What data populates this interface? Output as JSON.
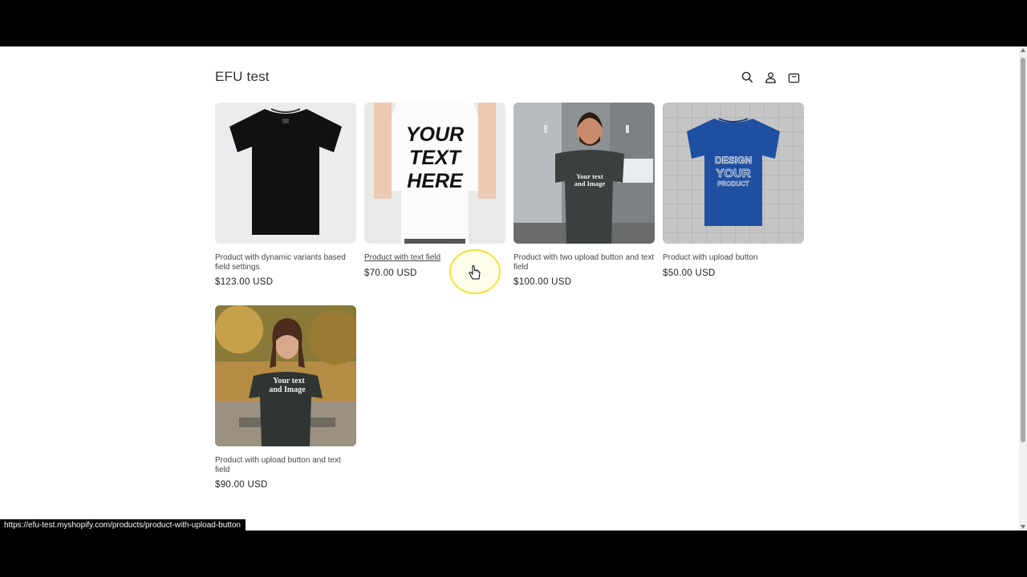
{
  "store": {
    "name": "EFU test"
  },
  "header_icons": [
    "search-icon",
    "account-icon",
    "cart-icon"
  ],
  "products": [
    {
      "title": "Product with dynamic variants based field settings",
      "price": "$123.00 USD",
      "image": "black-tshirt"
    },
    {
      "title": "Product with text field",
      "price": "$70.00 USD",
      "image": "white-tshirt-your-text-here",
      "image_text": "YOUR TEXT HERE"
    },
    {
      "title": "Product with two upload button and text field",
      "price": "$100.00 USD",
      "image": "man-grey-tshirt",
      "image_text": "Your text and Image"
    },
    {
      "title": "Product with upload button",
      "price": "$50.00 USD",
      "image": "blue-tshirt-design",
      "image_text": "DESIGN YOUR PRODUCT"
    },
    {
      "title": "Product with upload button and text field",
      "price": "$90.00 USD",
      "image": "woman-grey-tshirt",
      "image_text": "Your text and Image"
    }
  ],
  "status_bar": {
    "url": "https://efu-test.myshopify.com/products/product-with-upload-button"
  },
  "colors": {
    "page_bg": "#ffffff",
    "frame_bg": "#000000",
    "text": "#333333",
    "cursor_highlight": "#ebe128"
  }
}
